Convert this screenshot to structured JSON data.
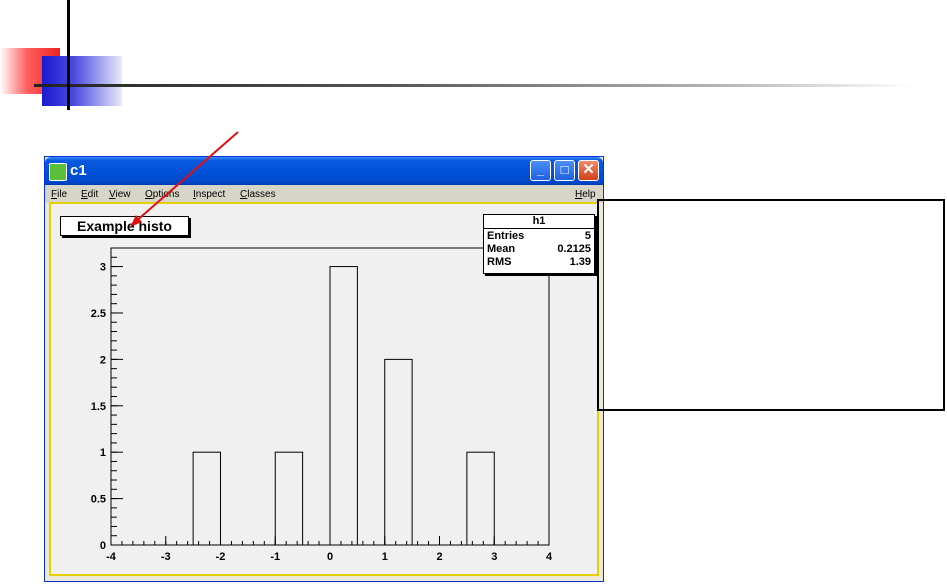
{
  "window": {
    "title": "c1",
    "controls": {
      "minimize": "_",
      "maximize": "□",
      "close": "✕"
    },
    "icon": "app-icon"
  },
  "menubar": {
    "items": [
      "File",
      "Edit",
      "View",
      "Options",
      "Inspect",
      "Classes"
    ],
    "help": "Help"
  },
  "histogram": {
    "title": "Example histo",
    "stats": {
      "name": "h1",
      "rows": [
        {
          "label": "Entries",
          "value": "5"
        },
        {
          "label": "Mean",
          "value": "0.2125"
        },
        {
          "label": "RMS",
          "value": "1.39"
        }
      ]
    }
  },
  "chart_data": {
    "type": "bar",
    "title": "Example histo",
    "xlim": [
      -4,
      4
    ],
    "ylim": [
      0,
      3.2
    ],
    "bin_width": 0.5,
    "bins": [
      {
        "low": -2.5,
        "high": -2.0,
        "value": 1
      },
      {
        "low": -1.0,
        "high": -0.5,
        "value": 1
      },
      {
        "low": 0.0,
        "high": 0.5,
        "value": 3
      },
      {
        "low": 1.0,
        "high": 1.5,
        "value": 2
      },
      {
        "low": 2.5,
        "high": 3.0,
        "value": 1
      }
    ],
    "x_ticks": [
      "-4",
      "-3",
      "-2",
      "-1",
      "0",
      "1",
      "2",
      "3",
      "4"
    ],
    "y_ticks": [
      "0",
      "0.5",
      "1",
      "1.5",
      "2",
      "2.5",
      "3"
    ],
    "grid": false,
    "legend": "none"
  },
  "colors": {
    "titlebar": "#0253d8",
    "canvas_border": "#e6d000",
    "arrow": "#e01010",
    "canvas_bg": "#f0f0f0"
  }
}
